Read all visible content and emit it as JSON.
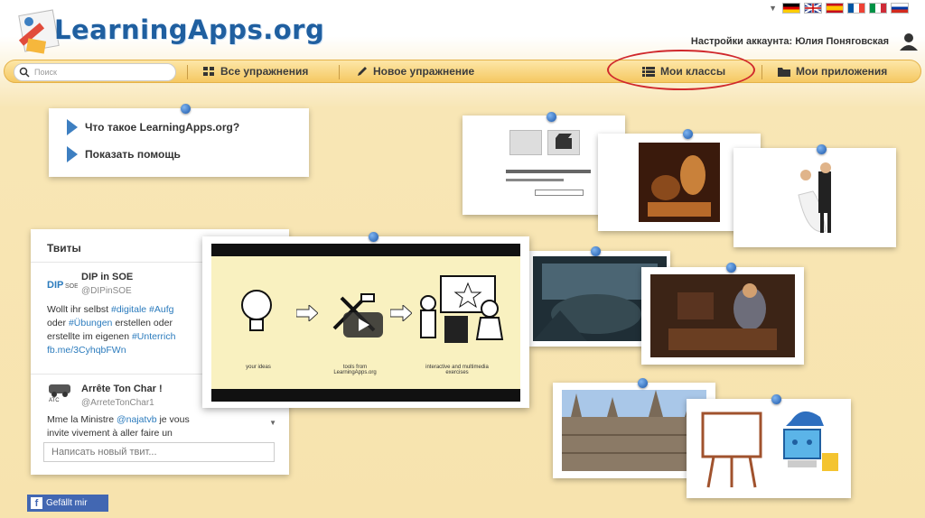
{
  "header": {
    "logo_text": "LearningApps.org",
    "account_text": "Настройки аккаунта: Юлия Поняговская"
  },
  "languages": [
    "de",
    "en",
    "es",
    "fr",
    "it",
    "ru"
  ],
  "toolbar": {
    "search_placeholder": "Поиск",
    "all_exercises": "Все упражнения",
    "new_exercise": "Новое упражнение",
    "my_classes": "Мои классы",
    "my_apps": "Мои приложения"
  },
  "help": {
    "what_is": "Что такое LearningApps.org?",
    "show_help": "Показать помощь"
  },
  "tweets": {
    "title": "Твиты",
    "items": [
      {
        "name": "DIP in SOE",
        "handle": "@DIPinSOE",
        "line1a": "Wollt ihr selbst ",
        "line1b": "#digitale #Aufg",
        "line2a": "oder ",
        "line2b": "#Übungen",
        "line2c": " erstellen oder",
        "line3a": "erstellte im eigenen ",
        "line3b": "#Unterrich",
        "line4": "fb.me/3CyhqbFWn"
      },
      {
        "name": "Arrête Ton Char !",
        "handle": "@ArreteTonChar1",
        "line1a": "Mme la Ministre ",
        "line1b": "@najatvb",
        "line1c": " je vous",
        "line2": "invite vivement à aller faire un"
      }
    ],
    "input_placeholder": "Написать новый твит..."
  },
  "video": {
    "label_ideas": "your ideas",
    "label_tools": "tools from LearningApps.org",
    "label_result": "interactive and multimedia exercises"
  },
  "facebook": {
    "like_label": "Gefällt mir"
  },
  "colors": {
    "accent": "#1f5fa0",
    "toolbar": "#f5c862",
    "highlight_circle": "#d0282c",
    "link": "#2b7bbd"
  }
}
